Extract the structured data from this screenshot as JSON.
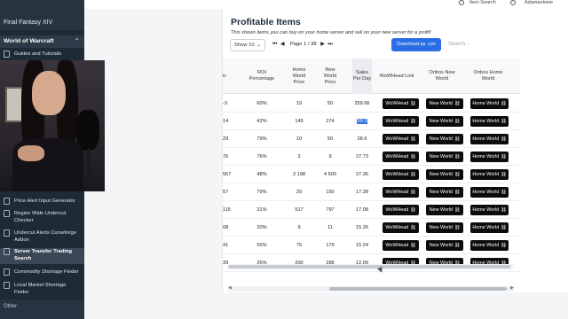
{
  "sidebar": {
    "top_title": "Final Fantasy XIV",
    "section": "World of Warcraft",
    "items": [
      {
        "label": "Guides and Tutorials"
      },
      {
        "label": "Price Alert Input Generator"
      },
      {
        "label": "Region Wide Undercut Checker"
      },
      {
        "label": "Undercut Alerts Curseforge Addon"
      },
      {
        "label": "Server Transfer Trading Search",
        "active": true
      },
      {
        "label": "Commodity Shortage Finder"
      },
      {
        "label": "Local Market Shortage Finder"
      }
    ],
    "footer": "Other"
  },
  "topbar": {
    "search_label": "Item Search",
    "user_label": "Adamantoise"
  },
  "card": {
    "title": "Profitable Items",
    "subtitle": "This shows items you can buy on your home server and sell on your new server for a profit!",
    "show_select": "Show 10",
    "pager_text": "Page 1 / 38",
    "download_label": "Download as .csv",
    "search_placeholder": "Search..."
  },
  "table": {
    "headers": [
      {
        "label": "ic"
      },
      {
        "label": "ROI Percentage"
      },
      {
        "label": "Home World Price"
      },
      {
        "label": "New World Price"
      },
      {
        "label": "Sales Per Day",
        "sorted": true
      },
      {
        "label": "WoWHead Link"
      },
      {
        "label": "Oribos New World"
      },
      {
        "label": "Oribos Home World"
      }
    ],
    "rows": [
      {
        "c0": "-3",
        "roi": "60%",
        "home": "19",
        "new": "50",
        "sales": "259.66"
      },
      {
        "c0": "14",
        "roi": "42%",
        "home": "149",
        "new": "274",
        "sales": "59.2",
        "sales_selected": true
      },
      {
        "c0": "29",
        "roi": "79%",
        "home": "10",
        "new": "50",
        "sales": "28.6"
      },
      {
        "c0": "76",
        "roi": "76%",
        "home": "2",
        "new": "9",
        "sales": "27.73"
      },
      {
        "c0": "557",
        "roi": "48%",
        "home": "2 198",
        "new": "4 500",
        "sales": "27.36"
      },
      {
        "c0": "57",
        "roi": "79%",
        "home": "29",
        "new": "150",
        "sales": "17.28"
      },
      {
        "c0": "115",
        "roi": "31%",
        "home": "517",
        "new": "797",
        "sales": "17.08"
      },
      {
        "c0": "08",
        "roi": "20%",
        "home": "9",
        "new": "11",
        "sales": "15.26"
      },
      {
        "c0": "41",
        "roi": "55%",
        "home": "75",
        "new": "179",
        "sales": "15.24"
      },
      {
        "c0": "39",
        "roi": "26%",
        "home": "200",
        "new": "288",
        "sales": "12.09"
      }
    ],
    "btn_wowhead": "WoWHead",
    "btn_new": "New World",
    "btn_home": "Home World"
  }
}
